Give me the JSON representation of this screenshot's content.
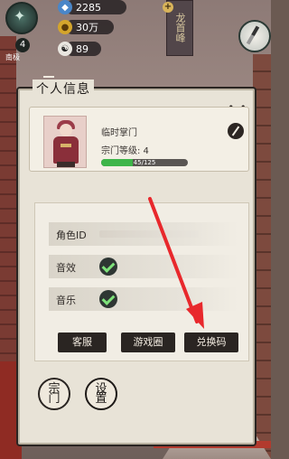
{
  "hud": {
    "player_level": "4",
    "player_label": "南极",
    "resources": [
      {
        "icon": "gem-icon",
        "value": "2285"
      },
      {
        "icon": "gold-coin-icon",
        "value": "30万"
      },
      {
        "icon": "yin-yang-icon",
        "value": "89"
      }
    ],
    "location_banner": "龙首峰"
  },
  "dialog": {
    "title": "个人信息",
    "profile": {
      "name": "临时掌门",
      "sect_level_label": "宗门等级: 4",
      "xp_text": "45/125",
      "xp_progress": 0.36
    },
    "settings": {
      "role_id_label": "角色ID",
      "sfx_label": "音效",
      "sfx_enabled": true,
      "music_label": "音乐",
      "music_enabled": true
    },
    "buttons": {
      "service": "客服",
      "game_circle": "游戏圈",
      "redeem_code": "兑换码"
    }
  },
  "bottom_nav": {
    "sect": "宗门",
    "settings": "设置"
  },
  "colors": {
    "arrow": "#e8282c",
    "xp_fill": "#3eb54a",
    "panel": "#e8e3d7",
    "ink": "#2a2522"
  }
}
